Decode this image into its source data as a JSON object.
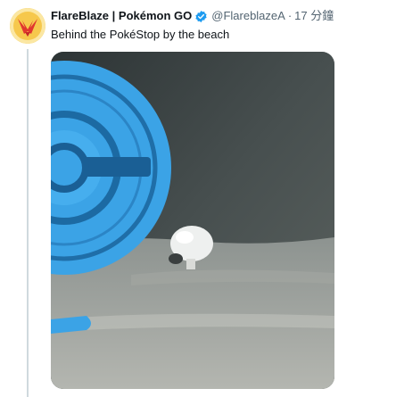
{
  "author": {
    "display_name": "FlareBlaze | Pokémon GO",
    "handle": "@FlareblazeA",
    "separator": "·",
    "time": "17 分鐘",
    "avatar_icon": "flame-bird-logo",
    "verified_icon": "verified-badge-icon",
    "verified_color": "#1d9bf0"
  },
  "tweet": {
    "text": "Behind the PokéStop by the beach"
  },
  "media": {
    "kind": "video-frame",
    "description_icon": "pokestop-disc-image"
  },
  "colors": {
    "avatar_bg": "#f3c237",
    "avatar_fg": "#e0372f",
    "pokestop_blue": "#3ba3e6",
    "text_primary": "#0f1419",
    "text_secondary": "#536471"
  }
}
